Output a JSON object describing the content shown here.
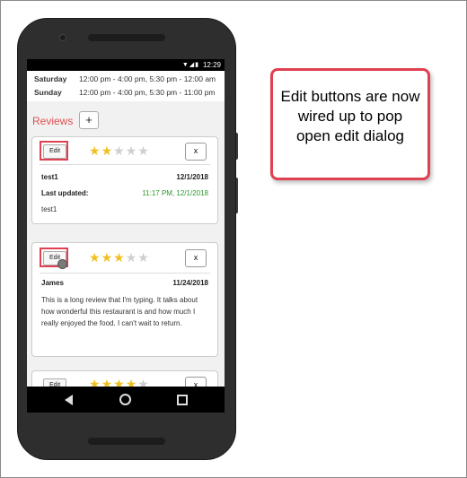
{
  "status_bar": {
    "icons": "▼◢▮",
    "time": "12:29"
  },
  "hours": [
    {
      "day": "Saturday",
      "value": "12:00 pm - 4:00 pm, 5:30 pm - 12:00 am"
    },
    {
      "day": "Sunday",
      "value": "12:00 pm - 4:00 pm, 5:30 pm - 11:00 pm"
    }
  ],
  "reviews": {
    "title": "Reviews",
    "add_label": "+",
    "items": [
      {
        "edit_label": "Edit",
        "close_label": "x",
        "rating": 2,
        "max_rating": 5,
        "name": "test1",
        "date": "12/1/2018",
        "updated_label": "Last updated:",
        "updated_value": "11:17 PM, 12/1/2018",
        "text": "test1"
      },
      {
        "edit_label": "Edit",
        "close_label": "x",
        "rating": 3,
        "max_rating": 5,
        "name": "James",
        "date": "11/24/2018",
        "text": "This is a long review that I'm typing. It talks about how wonderful this restaurant is and how much I really enjoyed the food. I can't wait to return."
      },
      {
        "edit_label": "Edit",
        "close_label": "x",
        "rating": 4,
        "max_rating": 5
      }
    ]
  },
  "callout": {
    "text": "Edit buttons are now wired up to pop open edit dialog"
  },
  "colors": {
    "highlight": "#e04050",
    "star_on": "#f0c020",
    "star_off": "#cfcfcf",
    "updated_green": "#2a9a2a",
    "reviews_title": "#e05050"
  },
  "icons": {
    "back": "back-triangle-icon",
    "home": "home-circle-icon",
    "recent": "recent-square-icon"
  }
}
